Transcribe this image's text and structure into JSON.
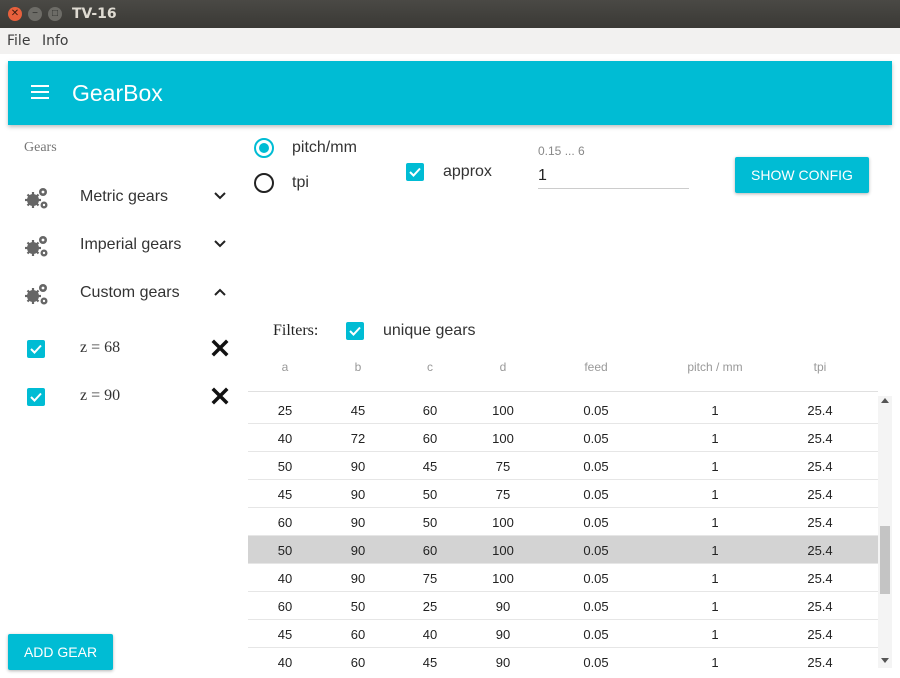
{
  "window": {
    "title": "TV-16"
  },
  "menubar": {
    "file": "File",
    "info": "Info"
  },
  "appbar": {
    "title": "GearBox"
  },
  "sidebar": {
    "header": "Gears",
    "items": [
      {
        "label": "Metric gears",
        "expanded": false
      },
      {
        "label": "Imperial gears",
        "expanded": false
      },
      {
        "label": "Custom gears",
        "expanded": true
      }
    ],
    "custom_gears": [
      {
        "label": "z = 68",
        "checked": true
      },
      {
        "label": "z = 90",
        "checked": true
      }
    ],
    "add_button": "ADD GEAR"
  },
  "controls": {
    "unit_options": [
      {
        "label": "pitch/mm",
        "selected": true
      },
      {
        "label": "tpi",
        "selected": false
      }
    ],
    "approx": {
      "label": "approx",
      "checked": true
    },
    "value_hint": "0.15 ... 6",
    "value": "1",
    "show_config": "SHOW CONFIG"
  },
  "filters": {
    "label": "Filters:",
    "unique_gears": {
      "label": "unique gears",
      "checked": true
    }
  },
  "table": {
    "headers": [
      "a",
      "b",
      "c",
      "d",
      "feed",
      "pitch / mm",
      "tpi"
    ],
    "selected_row": 5,
    "rows": [
      [
        "25",
        "45",
        "60",
        "100",
        "0.05",
        "1",
        "25.4"
      ],
      [
        "40",
        "72",
        "60",
        "100",
        "0.05",
        "1",
        "25.4"
      ],
      [
        "50",
        "90",
        "45",
        "75",
        "0.05",
        "1",
        "25.4"
      ],
      [
        "45",
        "90",
        "50",
        "75",
        "0.05",
        "1",
        "25.4"
      ],
      [
        "60",
        "90",
        "50",
        "100",
        "0.05",
        "1",
        "25.4"
      ],
      [
        "50",
        "90",
        "60",
        "100",
        "0.05",
        "1",
        "25.4"
      ],
      [
        "40",
        "90",
        "75",
        "100",
        "0.05",
        "1",
        "25.4"
      ],
      [
        "60",
        "50",
        "25",
        "90",
        "0.05",
        "1",
        "25.4"
      ],
      [
        "45",
        "60",
        "40",
        "90",
        "0.05",
        "1",
        "25.4"
      ],
      [
        "40",
        "60",
        "45",
        "90",
        "0.05",
        "1",
        "25.4"
      ]
    ]
  },
  "colors": {
    "accent": "#00bcd4",
    "selected_row": "#d3d3d3"
  }
}
